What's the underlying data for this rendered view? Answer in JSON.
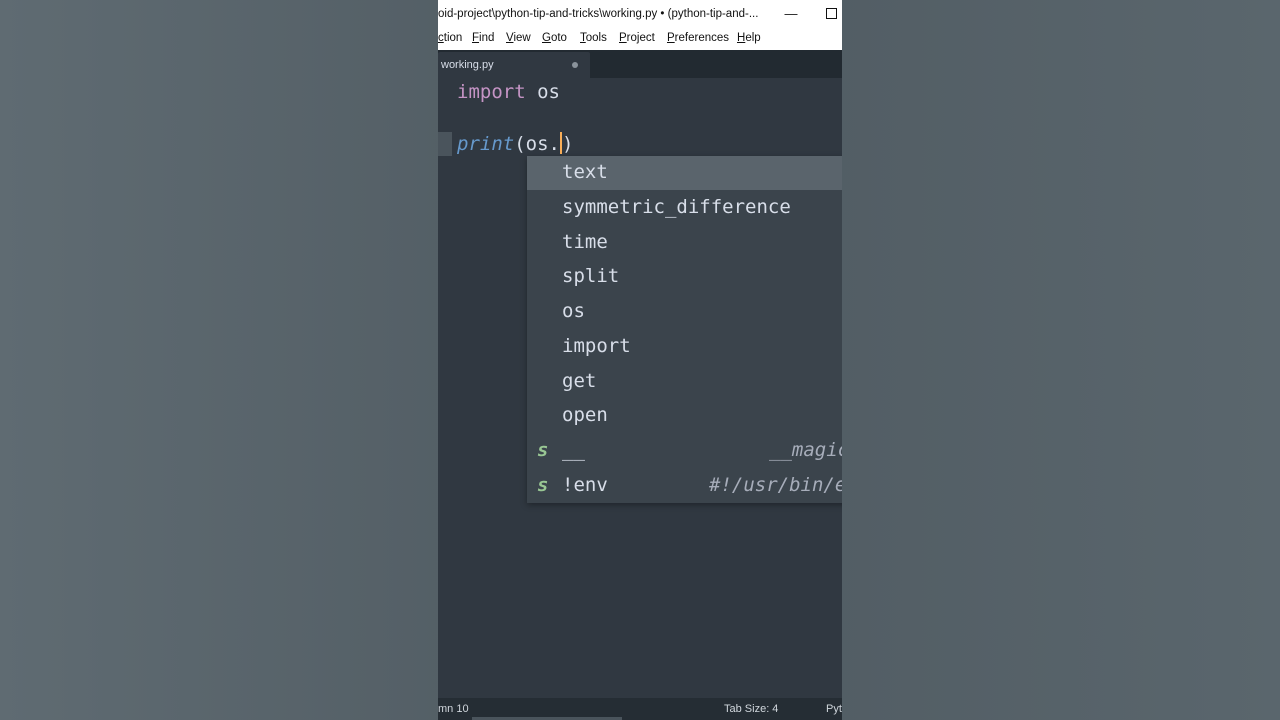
{
  "window": {
    "title": "oid-project\\python-tip-and-tricks\\working.py • (python-tip-and-...",
    "minimize_glyph": "—"
  },
  "menu": [
    "ction",
    "Find",
    "View",
    "Goto",
    "Tools",
    "Project",
    "Preferences",
    "Help"
  ],
  "tab": {
    "label": "working.py",
    "modified": true
  },
  "code": {
    "line1_kw": "import",
    "line1_rest": " os",
    "line3_fn": "print",
    "line3_before_caret": "(os.",
    "line3_after_caret": ")"
  },
  "autocomplete": {
    "selected_index": 0,
    "items": [
      {
        "label": "text",
        "kind": "",
        "hint": ""
      },
      {
        "label": "symmetric_difference",
        "kind": "",
        "hint": ""
      },
      {
        "label": "time",
        "kind": "",
        "hint": ""
      },
      {
        "label": "split",
        "kind": "",
        "hint": ""
      },
      {
        "label": "os",
        "kind": "",
        "hint": ""
      },
      {
        "label": "import",
        "kind": "",
        "hint": ""
      },
      {
        "label": "get",
        "kind": "",
        "hint": ""
      },
      {
        "label": "open",
        "kind": "",
        "hint": ""
      },
      {
        "label": "__",
        "kind": "s",
        "hint": "__magic"
      },
      {
        "label": "!env",
        "kind": "s",
        "hint": "#!/usr/bin/e"
      }
    ]
  },
  "status": {
    "position": "mn 10",
    "tab_size": "Tab Size: 4",
    "syntax": "Pyt"
  },
  "colors": {
    "editor_bg": "#303841",
    "keyword": "#c594c5",
    "function": "#6699cc",
    "caret": "#f9ae58",
    "snippet_kind": "#99c794"
  }
}
